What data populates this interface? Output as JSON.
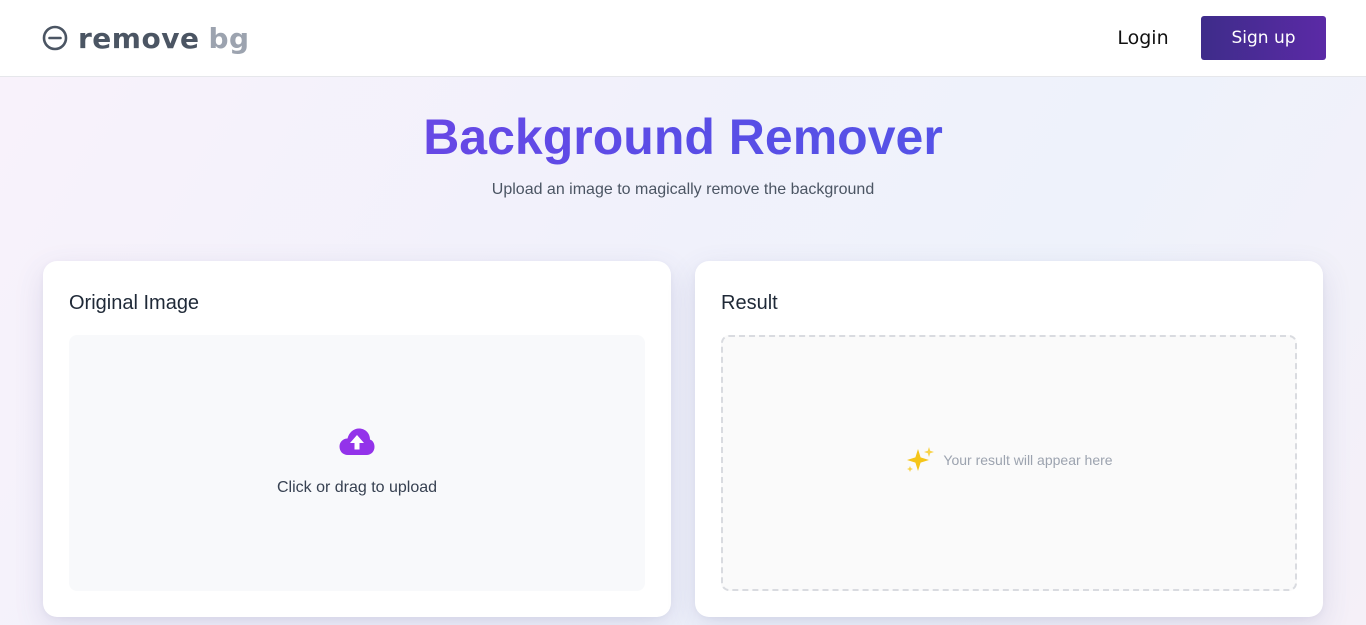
{
  "header": {
    "logo": {
      "word1": "remove",
      "word2": "bg",
      "icon": "minus-circle-icon"
    },
    "login_label": "Login",
    "signup_label": "Sign up"
  },
  "hero": {
    "title": "Background Remover",
    "subtitle": "Upload an image to magically remove the background"
  },
  "original_panel": {
    "title": "Original Image",
    "upload_icon": "cloud-upload-icon",
    "upload_label": "Click or drag to upload"
  },
  "result_panel": {
    "title": "Result",
    "placeholder_icon": "sparkles-icon",
    "placeholder_text": "Your result will appear here"
  },
  "colors": {
    "brand_purple": "#6a4be0",
    "signup_gradient_start": "#3e2c8a",
    "signup_gradient_end": "#5b2aa6",
    "upload_icon": "#9333ea",
    "sparkle": "#f5c518"
  }
}
